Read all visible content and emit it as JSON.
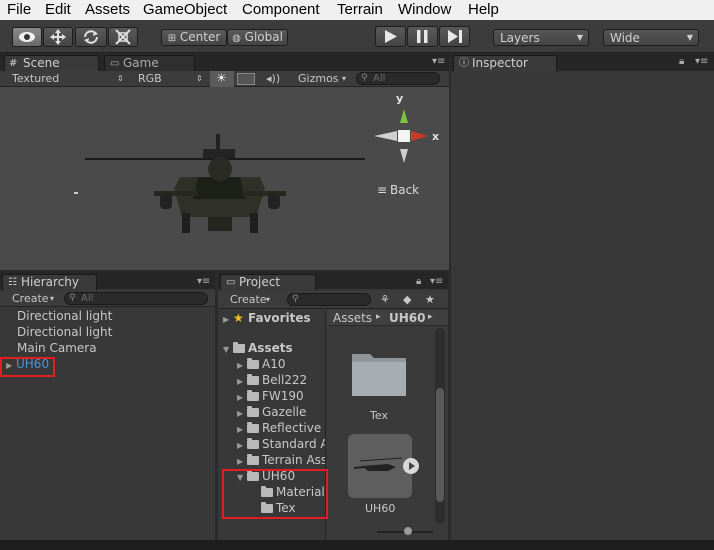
{
  "menu": [
    "File",
    "Edit",
    "Assets",
    "GameObject",
    "Component",
    "Terrain",
    "Window",
    "Help"
  ],
  "toolbar": {
    "pivot_label": "Center",
    "space_label": "Global",
    "layers_label": "Layers",
    "layout_label": "Wide"
  },
  "scene": {
    "tab_scene": "Scene",
    "tab_game": "Game",
    "render_mode": "Textured",
    "color_mode": "RGB",
    "gizmos_label": "Gizmos",
    "search_placeholder": "All",
    "gizmo_y": "y",
    "gizmo_x": "x",
    "view_label": "Back"
  },
  "inspector": {
    "tab": "Inspector"
  },
  "hierarchy": {
    "tab": "Hierarchy",
    "create_label": "Create",
    "search_placeholder": "All",
    "items": [
      "Directional light",
      "Directional light",
      "Main Camera",
      "UH60"
    ]
  },
  "project": {
    "tab": "Project",
    "create_label": "Create",
    "favorites_label": "Favorites",
    "assets_label": "Assets",
    "folders": [
      "A10",
      "Bell222",
      "FW190",
      "Gazelle",
      "Reflective S",
      "Standard A",
      "Terrain Ass",
      "UH60"
    ],
    "uh60_children": [
      "Materials",
      "Tex"
    ],
    "breadcrumb_root": "Assets",
    "breadcrumb_current": "UH60",
    "grid_items": [
      "Tex",
      "UH60"
    ]
  },
  "colors": {
    "highlight": "#e02020",
    "selected_text": "#4f93d4"
  }
}
